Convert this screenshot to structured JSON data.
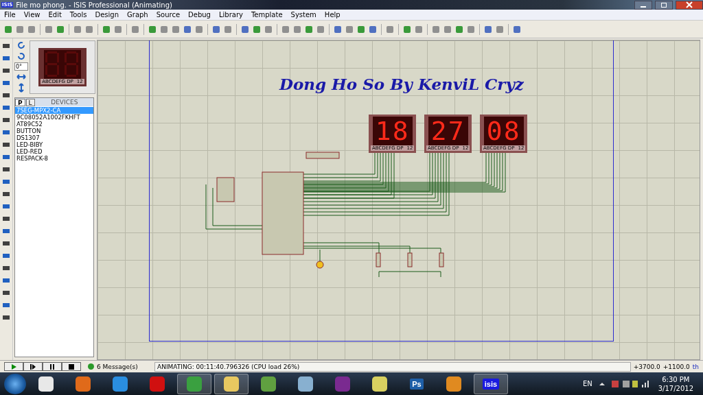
{
  "window": {
    "title": "File mo phong. - ISIS Professional (Animating)",
    "app_badge": "ISIS"
  },
  "menu": [
    {
      "label": "File"
    },
    {
      "label": "View"
    },
    {
      "label": "Edit"
    },
    {
      "label": "Tools"
    },
    {
      "label": "Design"
    },
    {
      "label": "Graph"
    },
    {
      "label": "Source"
    },
    {
      "label": "Debug"
    },
    {
      "label": "Library"
    },
    {
      "label": "Template"
    },
    {
      "label": "System"
    },
    {
      "label": "Help"
    }
  ],
  "rotation": {
    "value": "0°"
  },
  "preview": {
    "pin_label": "ABCDEFG DP",
    "pin_number": "12"
  },
  "devices": {
    "tabs": [
      {
        "label": "P",
        "selected": true
      },
      {
        "label": "L",
        "selected": false
      }
    ],
    "header": "DEVICES",
    "items": [
      {
        "label": "7SEG-MPX2-CA",
        "selected": true
      },
      {
        "label": "9C08052A1002FKHFT",
        "selected": false
      },
      {
        "label": "AT89C52",
        "selected": false
      },
      {
        "label": "BUTTON",
        "selected": false
      },
      {
        "label": "DS1307",
        "selected": false
      },
      {
        "label": "LED-BIBY",
        "selected": false
      },
      {
        "label": "LED-RED",
        "selected": false
      },
      {
        "label": "RESPACK-8",
        "selected": false
      }
    ]
  },
  "canvas": {
    "title": "Dong Ho So By KenviL Cryz",
    "displays": [
      {
        "digits": "18",
        "pin_label": "ABCDEFG DP",
        "pin_number": "12"
      },
      {
        "digits": "27",
        "pin_label": "ABCDEFG DP",
        "pin_number": "12"
      },
      {
        "digits": "08",
        "pin_label": "ABCDEFG DP",
        "pin_number": "12"
      }
    ]
  },
  "status_bar": {
    "messages": "6 Message(s)",
    "status": "ANIMATING: 00:11:40.796326 (CPU load 26%)",
    "x": "+3700.0",
    "y": "+1100.0",
    "units": "th"
  },
  "taskbar": {
    "apps": [
      {
        "kind": "keys",
        "selected": false
      },
      {
        "kind": "firefox",
        "selected": false
      },
      {
        "kind": "ie",
        "selected": false
      },
      {
        "kind": "opera",
        "selected": false
      },
      {
        "kind": "chrome",
        "selected": true
      },
      {
        "kind": "explorer",
        "selected": true
      },
      {
        "kind": "notepad",
        "selected": false
      },
      {
        "kind": "paint",
        "selected": false
      },
      {
        "kind": "messenger",
        "selected": false
      },
      {
        "kind": "chat",
        "selected": false
      },
      {
        "kind": "ps",
        "label": "Ps",
        "selected": false
      },
      {
        "kind": "player",
        "selected": false
      },
      {
        "kind": "isis",
        "label": "isis",
        "selected": true
      }
    ],
    "language": "EN",
    "time": "6:30 PM",
    "date": "3/17/2012"
  }
}
